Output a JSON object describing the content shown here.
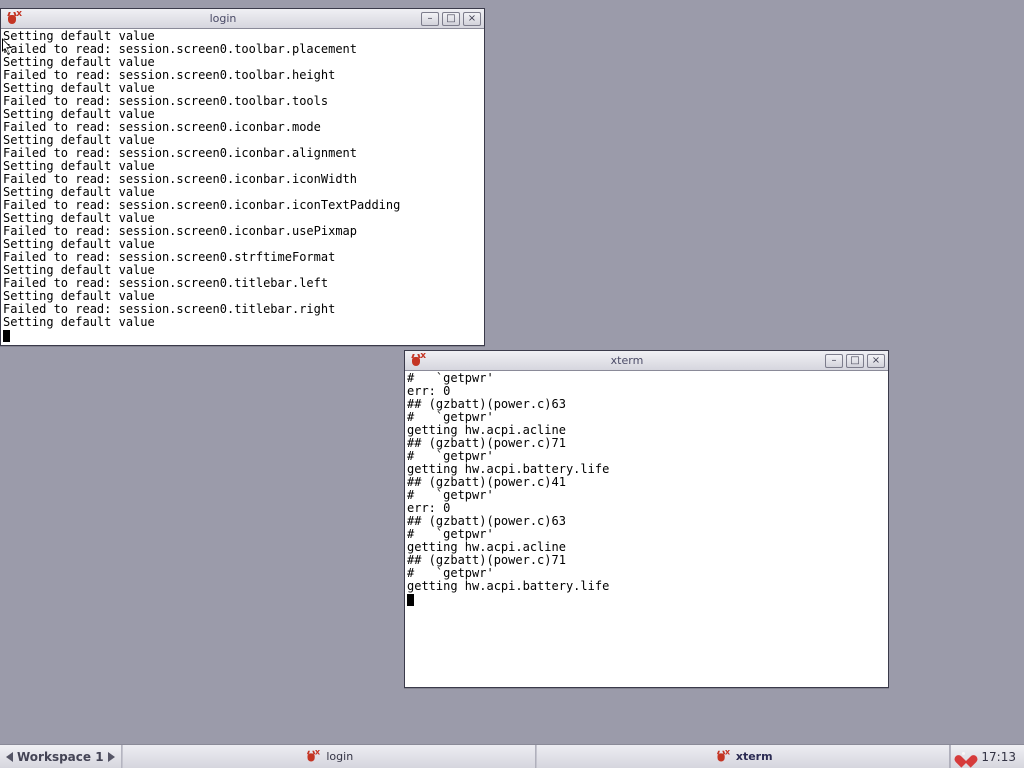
{
  "desktop": {
    "bg": "#9b9baa"
  },
  "windows": {
    "login": {
      "title": "login",
      "lines": [
        "Setting default value",
        "Failed to read: session.screen0.toolbar.placement",
        "Setting default value",
        "Failed to read: session.screen0.toolbar.height",
        "Setting default value",
        "Failed to read: session.screen0.toolbar.tools",
        "Setting default value",
        "Failed to read: session.screen0.iconbar.mode",
        "Setting default value",
        "Failed to read: session.screen0.iconbar.alignment",
        "Setting default value",
        "Failed to read: session.screen0.iconbar.iconWidth",
        "Setting default value",
        "Failed to read: session.screen0.iconbar.iconTextPadding",
        "Setting default value",
        "Failed to read: session.screen0.iconbar.usePixmap",
        "Setting default value",
        "Failed to read: session.screen0.strftimeFormat",
        "Setting default value",
        "Failed to read: session.screen0.titlebar.left",
        "Setting default value",
        "Failed to read: session.screen0.titlebar.right",
        "Setting default value"
      ]
    },
    "xterm": {
      "title": "xterm",
      "lines": [
        "#   `getpwr'",
        "err: 0",
        "",
        "## (gzbatt)(power.c)63",
        "#   `getpwr'",
        "getting hw.acpi.acline",
        "",
        "## (gzbatt)(power.c)71",
        "#   `getpwr'",
        "getting hw.acpi.battery.life",
        "",
        "## (gzbatt)(power.c)41",
        "#   `getpwr'",
        "err: 0",
        "",
        "## (gzbatt)(power.c)63",
        "#   `getpwr'",
        "getting hw.acpi.acline",
        "",
        "## (gzbatt)(power.c)71",
        "#   `getpwr'",
        "getting hw.acpi.battery.life",
        ""
      ]
    }
  },
  "window_controls": {
    "minimize_glyph": "–",
    "maximize_glyph": "□",
    "close_glyph": "×"
  },
  "taskbar": {
    "workspace_label": "Workspace 1",
    "tasks": [
      {
        "label": "login",
        "icon": "beastie-icon",
        "active": false
      },
      {
        "label": "xterm",
        "icon": "beastie-icon",
        "active": true
      }
    ],
    "clock": "17:13",
    "tray_icon": "heart-icon"
  }
}
